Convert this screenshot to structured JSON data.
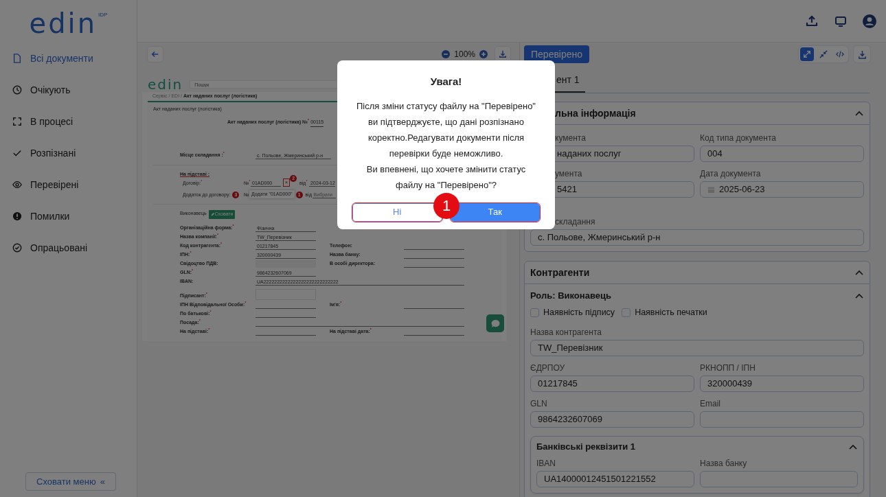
{
  "sidebar": {
    "logo": {
      "text": "edin",
      "superscript": "IDP"
    },
    "items": [
      {
        "label": "Всі документи",
        "selected": true
      },
      {
        "label": "Очікують",
        "selected": false
      },
      {
        "label": "В процесі",
        "selected": false
      },
      {
        "label": "Розпізнані",
        "selected": false
      },
      {
        "label": "Перевірені",
        "selected": false
      },
      {
        "label": "Помилки",
        "selected": false
      },
      {
        "label": "Опрацьовані",
        "selected": false
      }
    ],
    "collapse_button": {
      "label": "Сховати меню",
      "icon": "«"
    }
  },
  "viewer": {
    "zoom": "100%",
    "document": {
      "logo": "edin",
      "search_placeholder": "Пошук",
      "breadcrumb": "Сервіс / EDI / **Акт наданих послуг (логістика)**",
      "doc_type": "Акт наданих послуг (логістика)",
      "heading": "Акт наданих послуг (логістика) №$^{*}$",
      "number": "00115",
      "place": {
        "label": "Місце складання :$^{*}$",
        "value": "с. Польове, Жмеринський р-н"
      },
      "basis_title": "На підставі :",
      "contract": {
        "label": "Договір:$^{*}$",
        "no_label": "№$^{*}$",
        "number": "01AD000",
        "clear": "×",
        "marker": "2",
        "date_label": "від$^{*}$",
        "date": "2024-03-12"
      },
      "annex": {
        "label": "Додаток до договору:",
        "marker": "3",
        "no_label": "№",
        "suggestion": "Додати \"01AD000\"",
        "suggestion_marker": "1",
        "date_label": "від",
        "date": "Вибрати"
      },
      "executor": {
        "label": "Виконавець",
        "button": "Сховати"
      },
      "rows": [
        {
          "label": "Організаційна форма:$^{*}$",
          "value": "Фізична",
          "kind": "select"
        },
        {
          "label": "Назва компанії:$^{*}$",
          "value": "TW_Перевізник",
          "kind": "line"
        },
        {
          "label": "Код контрагента:$^{*}$",
          "value": "01217845",
          "kind": "line",
          "right_label": "Телефон:"
        },
        {
          "label": "ІПН:$^{*}$",
          "value": "320000439",
          "kind": "line",
          "right_label": "Назва банку:"
        },
        {
          "label": "Свідоцтво ПДВ:",
          "kind": "disabled",
          "right_label": "В особі директора:"
        },
        {
          "label": "GLN:$^{*}$",
          "value": "9864232607069",
          "kind": "line"
        },
        {
          "label": "IBAN:",
          "value": "UA2222222222222222222222222222",
          "kind": "wide"
        },
        {
          "label": "Підписант:$^{*}$",
          "kind": "box"
        },
        {
          "label": "ІПН Відповідальної Особи:$^{*}$",
          "kind": "line",
          "right_label": "Ім'я:$^{*}$"
        },
        {
          "label": "По батькові:$^{*}$",
          "kind": "line"
        },
        {
          "label": "Посада:$^{*}$",
          "kind": "wide"
        },
        {
          "label": "На підставі:$^{*}$",
          "kind": "line",
          "right_label": "На підставі дата:$^{*}$"
        }
      ]
    }
  },
  "panel": {
    "status_button": "Перевірено",
    "view_modes": [
      {
        "selected": true
      },
      {
        "selected": false
      },
      {
        "selected": false
      }
    ],
    "tabs": [
      {
        "label": "ент 1",
        "selected": true
      }
    ],
    "sections": [
      {
        "title": "льна інформація",
        "expanded": true,
        "fields": [
          {
            "label": "кумента",
            "value": "наданих послуг",
            "kind": "text",
            "wide": false
          },
          {
            "label": "Код типа документа",
            "value": "004",
            "kind": "text",
            "wide": false
          },
          {
            "label": "умента",
            "value": "5421",
            "kind": "text",
            "wide": false
          },
          {
            "label": "Дата документа",
            "value": "2025-06-23",
            "kind": "date",
            "wide": false
          },
          {
            "label": "складання",
            "value": "с. Польове, Жмеринський р-н",
            "kind": "text",
            "wide": true
          }
        ]
      },
      {
        "title": "Контрагенти",
        "expanded": true,
        "groups": [
          {
            "title": "Роль: Виконавець",
            "expanded": true,
            "checkboxes": [
              {
                "label": "Наявність підпису",
                "checked": false
              },
              {
                "label": "Наявність печатки",
                "checked": false
              }
            ],
            "fields": [
              {
                "label": "Назва контрагента",
                "value": "TW_Перевізник",
                "kind": "text",
                "wide": true
              },
              {
                "label": "ЄДРПОУ",
                "value": "01217845",
                "kind": "text",
                "wide": false
              },
              {
                "label": "РКНОПП / ІПН",
                "value": "320000439",
                "kind": "text",
                "wide": false
              },
              {
                "label": "GLN",
                "value": "9864232607069",
                "kind": "text",
                "wide": false
              },
              {
                "label": "Email",
                "kind": "text",
                "wide": false
              }
            ],
            "subsections": [
              {
                "title": "Банківські реквізити 1",
                "expanded": true,
                "fields": [
                  {
                    "label": "IBAN",
                    "value": "UA14000012451501221552",
                    "kind": "text",
                    "wide": false
                  },
                  {
                    "label": "Назва банку",
                    "kind": "text",
                    "wide": false
                  }
                ]
              }
            ]
          }
        ]
      }
    ]
  },
  "dialog": {
    "title": "Увага!",
    "paragraphs": [
      "Після зміни статусу файлу на \"Перевірено\" ви підтверджуєте, що дані розпізнано коректно.Редагувати документи після перевірки буде неможливо.",
      "Ви впевнені, що хочете змінити статус файлу на \"Перевірено\"?"
    ],
    "buttons": [
      {
        "label": "Ні",
        "kind": "secondary",
        "highlighted": true
      },
      {
        "label": "Так",
        "kind": "primary",
        "highlighted": true
      }
    ],
    "marker": "1"
  }
}
